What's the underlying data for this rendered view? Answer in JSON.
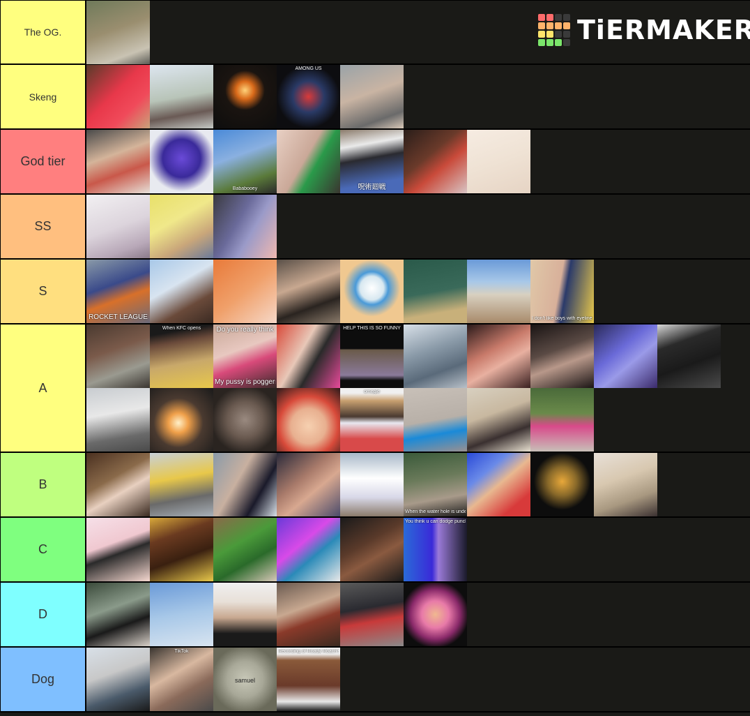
{
  "brand": {
    "name": "TiERMAKER",
    "logo_grid_colors": [
      "#ff6b6b",
      "#ff6b6b",
      "#3a3a3a",
      "#3a3a3a",
      "#ffb36b",
      "#ffb36b",
      "#ffb36b",
      "#ffb36b",
      "#ffe46b",
      "#ffe46b",
      "#3a3a3a",
      "#3a3a3a",
      "#7be66b",
      "#7be66b",
      "#7be66b",
      "#3a3a3a"
    ]
  },
  "tiers": [
    {
      "label": "The OG.",
      "color": "#ffff7f",
      "small": true,
      "items": [
        {
          "desc": "aerial landscape game view",
          "bg": "linear-gradient(160deg,#6f7a5a,#9a8e6f 45%,#c9c3b3 80%,#5b5b55)"
        }
      ]
    },
    {
      "label": "Skeng",
      "color": "#ffff7f",
      "small": true,
      "items": [
        {
          "desc": "man in red robe singing",
          "bg": "linear-gradient(135deg,#5a3a2a,#e8384a 45%,#f04a5a 70%,#c9a37a)"
        },
        {
          "desc": "cow charging person",
          "bg": "linear-gradient(170deg,#dde6f0,#b8c4b8 50%,#6a5a55 75%,#c4c8c4)"
        },
        {
          "desc": "burning figure at night",
          "bg": "radial-gradient(circle at 50% 40%,#ffd27a,#d96a1a 18%,#1a1410 40%,#0d0d0d)"
        },
        {
          "desc": "among us sneaker character",
          "bg": "radial-gradient(circle at 50% 50%,#d93a3a,#2a3a66 35%,#0d0d10 70%)",
          "caption": "AMONG US",
          "caption_pos": "top"
        },
        {
          "desc": "group of shirtless men",
          "bg": "linear-gradient(160deg,#9aa3a8,#c9b4a3 45%,#6a6a6a 80%,#d8c8b8)"
        }
      ]
    },
    {
      "label": "God tier",
      "color": "#ff7f7f",
      "small": false,
      "items": [
        {
          "desc": "person with red mask",
          "bg": "linear-gradient(160deg,#4a4a4a,#d4b49a 40%,#c9584a 65%,#e6e0d8)"
        },
        {
          "desc": "beerus cartoon",
          "bg": "radial-gradient(circle at 50% 45%,#6a4ad8,#3a2a9a 40%,#e8eaf0 70%)"
        },
        {
          "desc": "man with glasses selfie",
          "bg": "linear-gradient(160deg,#4a8ad8,#8ab0e0 40%,#5a7a3a 75%,#2a2a2a)",
          "caption": "Bababooey",
          "caption_pos": "bottom"
        },
        {
          "desc": "kid with green headphones",
          "bg": "linear-gradient(120deg,#e8d0c4,#caa898 45%,#2a9a4a 60%,#3a3530)"
        },
        {
          "desc": "jujutsu kaisen figure",
          "bg": "linear-gradient(170deg,#8a7a6a,#eaeaea 25%,#2a2a30 45%,#4a6ab8 80%)",
          "caption": "呪術廻戦",
          "caption_pos": "bottom",
          "caption_big": true
        },
        {
          "desc": "man punching",
          "bg": "linear-gradient(140deg,#2a1e1a,#6a3a2a 40%,#c94a3a 60%,#d8c4c4)"
        },
        {
          "desc": "sketch drawing face",
          "bg": "linear-gradient(160deg,#f6ece2,#efe2d4 50%,#e6d4c4)"
        }
      ]
    },
    {
      "label": "SS",
      "color": "#ffbf7f",
      "small": false,
      "items": [
        {
          "desc": "person falling indoors",
          "bg": "linear-gradient(160deg,#f2f0f2,#dcd4dc 50%,#b8a8b8 80%,#8a7a8a)"
        },
        {
          "desc": "kid in yellow doorway",
          "bg": "linear-gradient(150deg,#e8e06a,#f0e88a 40%,#c9a67a 70%,#6a7a9a)"
        },
        {
          "desc": "anime angry face",
          "bg": "linear-gradient(120deg,#3a3a40,#6a6a9a 40%,#9a9ac8 60%,#f0b8b0)"
        }
      ]
    },
    {
      "label": "S",
      "color": "#ffdf7f",
      "small": false,
      "items": [
        {
          "desc": "rocket league car",
          "bg": "linear-gradient(160deg,#8a9aa8,#3a4a8a 40%,#d8702a 60%,#6a6a7a)",
          "caption": "ROCKET LEAGUE",
          "caption_pos": "bottom",
          "caption_big": true
        },
        {
          "desc": "kid smiling blue",
          "bg": "linear-gradient(150deg,#a8c8e8,#d8e4f0 40%,#6a4a3a 70%,#3a2a22)"
        },
        {
          "desc": "orange blurred face",
          "bg": "linear-gradient(140deg,#e87a3a,#f0a06a 50%,#f6d8c8)"
        },
        {
          "desc": "two people in car",
          "bg": "linear-gradient(160deg,#5a5048,#c8a890 40%,#2a2420 70%,#8a7a6a)"
        },
        {
          "desc": "cartoon big eyes",
          "bg": "radial-gradient(circle at 50% 45%,#ffffff,#d8e8f0 25%,#4a9ad8 35%,#f0c890 60%)"
        },
        {
          "desc": "cartoon with guitar",
          "bg": "linear-gradient(170deg,#2a5a4a,#3a6a5a 50%,#c8b07a 80%)"
        },
        {
          "desc": "desert buildings",
          "bg": "linear-gradient(180deg,#6a9ad8,#a8c8e8 35%,#d8d0c0 55%,#a88a6a)"
        },
        {
          "desc": "two men facepalm",
          "bg": "linear-gradient(100deg,#e0c8a8,#d8b09a 45%,#2a3a6a 55%,#e8c84a)",
          "caption": "I don't like boys with eyeliner",
          "caption_pos": "bottom"
        }
      ]
    },
    {
      "label": "A",
      "color": "#ffff7f",
      "small": false,
      "items": [
        {
          "desc": "rustic outdoor scene",
          "bg": "linear-gradient(160deg,#4a3a30,#7a5a4a 40%,#9a9a90 70%,#3a3530)"
        },
        {
          "desc": "clash royale characters",
          "bg": "linear-gradient(170deg,#1a1a1a 15%,#6a4a3a 30%,#c8a86a 60%,#e8c84a)",
          "caption": "When KFC opens",
          "caption_pos": "top"
        },
        {
          "desc": "anime girl meme",
          "bg": "linear-gradient(160deg,#c8a898,#e8c8c0 40%,#d84a7a 60%,#3a2a2a)",
          "caption": "Do you really think",
          "caption_pos": "top",
          "caption_big": true,
          "caption2": "My pussy is poggers?"
        },
        {
          "desc": "man and pink hood",
          "bg": "linear-gradient(120deg,#d84a3a,#e8c8b8 40%,#2a2a2a 60%,#e84a9a)"
        },
        {
          "desc": "help this is so funny",
          "bg": "linear-gradient(180deg,#0d0d0d 38%,#6a5a4a 40%,#8a7a9a 80%,#0d0d0d 88%)",
          "caption": "HELP THIS IS SO FUNNY",
          "caption_pos": "top"
        },
        {
          "desc": "person on road",
          "bg": "linear-gradient(160deg,#d8e0e8,#8a9aa8 40%,#5a6a7a 70%,#b8c0c8)"
        },
        {
          "desc": "man screaming",
          "bg": "linear-gradient(150deg,#2a1a1a,#c87a6a 40%,#e8b0a0 60%,#3a2020)"
        },
        {
          "desc": "dark figure",
          "bg": "linear-gradient(160deg,#1a1414,#5a4a44 40%,#b8988a 60%,#1a1414)"
        },
        {
          "desc": "cartoon cat blue",
          "bg": "linear-gradient(140deg,#2a2a5a,#6a6ad8 40%,#9a9ae8 60%,#3a2a6a)"
        },
        {
          "desc": "batman lighter",
          "bg": "linear-gradient(160deg,#d8d8d8,#2a2a2a 30%,#1a1a1a 60%,#4a4a4a)"
        },
        {
          "desc": "car drift person",
          "bg": "linear-gradient(170deg,#c8ccd0,#e8e8e8 40%,#6a6a6a 75%,#4a4a4a)"
        },
        {
          "desc": "explosion",
          "bg": "radial-gradient(circle at 45% 55%,#fff0c8,#f0a04a 20%,#4a3a30 50%,#1a1a1a)"
        },
        {
          "desc": "rat face",
          "bg": "radial-gradient(circle at 50% 50%,#9a8a80,#6a5a50 40%,#2a2420 75%)"
        },
        {
          "desc": "mario face",
          "bg": "radial-gradient(circle at 50% 60%,#f6d0b0,#e8b090 35%,#d84a3a 60%,#2a1a1a)"
        },
        {
          "desc": "omegle chat",
          "bg": "linear-gradient(180deg,#f0f0f0 8%,#c8a070 20%,#4a3a30 45%,#e8e8f0 55%,#d84a4a 80%)",
          "caption": "omegle",
          "caption_pos": "top"
        },
        {
          "desc": "man in blue shirt",
          "bg": "linear-gradient(170deg,#c8c0b8,#b8b0a8 50%,#1a8ad8 70%,#9a9090)"
        },
        {
          "desc": "man lying on bed",
          "bg": "linear-gradient(160deg,#d8d0c0,#c8b8a0 40%,#3a3030 70%,#e8e0d0)"
        },
        {
          "desc": "handstand outdoors",
          "bg": "linear-gradient(180deg,#4a6a3a,#6a8a4a 40%,#d84a8a 60%,#c8c0b8)"
        }
      ]
    },
    {
      "label": "B",
      "color": "#bfff7f",
      "small": false,
      "items": [
        {
          "desc": "kids in room",
          "bg": "linear-gradient(150deg,#4a3020,#8a6a4a 40%,#e8d0c0 60%,#3a2a20)"
        },
        {
          "desc": "toy car crash",
          "bg": "linear-gradient(170deg,#c8d0d8,#e8c84a 40%,#6a6a6a 70%,#a8b0b8)"
        },
        {
          "desc": "elon musk smiling",
          "bg": "linear-gradient(120deg,#8a9aa8,#c8b0a0 40%,#1a1a2a 70%,#d8e0e8)"
        },
        {
          "desc": "person shirtless",
          "bg": "linear-gradient(140deg,#2a2a3a,#a87a6a 40%,#d8a890 60%,#4a4a6a)"
        },
        {
          "desc": "white cone figure",
          "bg": "linear-gradient(180deg,#a8b8c8,#ffffff 40%,#d8d8e8 70%,#8a7a6a)"
        },
        {
          "desc": "water hole attack",
          "bg": "linear-gradient(170deg,#3a5a3a,#6a7a5a 40%,#a89a8a 70%,#1a1a1a)",
          "caption": "When the water hole is under attack",
          "caption_pos": "bottom"
        },
        {
          "desc": "dracula cartoon",
          "bg": "linear-gradient(140deg,#2a4ad8,#6a8ae8 30%,#e8b890 50%,#d83a3a 80%)"
        },
        {
          "desc": "blurry orange figure",
          "bg": "radial-gradient(circle at 50% 45%,#e8a83a,#8a6a2a 30%,#0d0d0d 60%)"
        },
        {
          "desc": "glass drink",
          "bg": "linear-gradient(160deg,#e8e0d8,#d8c8b0 40%,#a89880 70%,#3a3030)"
        }
      ]
    },
    {
      "label": "C",
      "color": "#7fff7f",
      "small": false,
      "items": [
        {
          "desc": "anime cosplay girl",
          "bg": "linear-gradient(160deg,#f6e0e8,#f0c8d0 40%,#2a2a2a 55%,#f6d8d0)"
        },
        {
          "desc": "kid laughing",
          "bg": "linear-gradient(160deg,#d8a83a,#6a3a20 30%,#3a2010 60%,#e8c84a)"
        },
        {
          "desc": "kermit frog",
          "bg": "linear-gradient(150deg,#8a6a4a,#4a9a3a 40%,#2a6a2a 65%,#d8c8b8)"
        },
        {
          "desc": "purple cartoon jersey",
          "bg": "linear-gradient(140deg,#6a3ad8,#d84ae8 40%,#2a8ab8 60%,#e8e8e8)"
        },
        {
          "desc": "woman speaking",
          "bg": "linear-gradient(150deg,#1a1a1a,#5a3a2a 40%,#8a5a40 60%,#1a1a1a)"
        },
        {
          "desc": "masked blue duet",
          "bg": "linear-gradient(90deg,#2a6ad8,#3a2ad8 45%,#9a7ad8 55%,#1a1a2a)",
          "caption": "You think u can dodge punches",
          "caption_pos": "top"
        }
      ]
    },
    {
      "label": "D",
      "color": "#7fffff",
      "small": false,
      "items": [
        {
          "desc": "people dancing",
          "bg": "linear-gradient(160deg,#3a4a3a,#8a9a8a 40%,#1a1a1a 65%,#d8d0c8)"
        },
        {
          "desc": "climbing pole sky",
          "bg": "linear-gradient(170deg,#6a9ad8,#a8c8e8 50%,#d8e4f0)"
        },
        {
          "desc": "man with glasses",
          "bg": "linear-gradient(180deg,#f0f0f0,#e8e0d8 30%,#c8a890 55%,#1a1a1a 80%)"
        },
        {
          "desc": "truck damage",
          "bg": "linear-gradient(160deg,#6a5a50,#c8a890 40%,#8a3a2a 60%,#3a2a20)"
        },
        {
          "desc": "car and person",
          "bg": "linear-gradient(170deg,#5a5a5a,#2a2a30 40%,#c83a3a 60%,#8a8a8a)"
        },
        {
          "desc": "anime girl fisheye",
          "bg": "radial-gradient(circle at 50% 50%,#f0b890,#e87aa8 30%,#8a2a6a 55%,#0d0d0d 75%)"
        }
      ]
    },
    {
      "label": "Dog",
      "color": "#7fbfff",
      "small": false,
      "items": [
        {
          "desc": "men in bathroom",
          "bg": "linear-gradient(160deg,#d8e0e8,#c8c8c8 40%,#4a5a6a 70%,#1a1a1a)"
        },
        {
          "desc": "crowd fighting",
          "bg": "linear-gradient(150deg,#3a3530,#d8b8a0 40%,#8a6a5a 65%,#4a4a4a)",
          "caption": "TikTok",
          "caption_pos": "top"
        },
        {
          "desc": "rat close up samuel",
          "bg": "radial-gradient(circle at 50% 50%,#c8c8b8,#a8a898 40%,#6a6a5a 75%)",
          "caption": "samuel",
          "caption_pos": "mid"
        },
        {
          "desc": "horse with piano",
          "bg": "linear-gradient(180deg,#f0f0f0 10%,#8a5a3a 20%,#6a3a2a 60%,#e8e8e8 85%,#1a1a1a)",
          "caption": "Recording of Roady Roach's \"Sailor\"",
          "caption_pos": "top"
        }
      ]
    }
  ]
}
